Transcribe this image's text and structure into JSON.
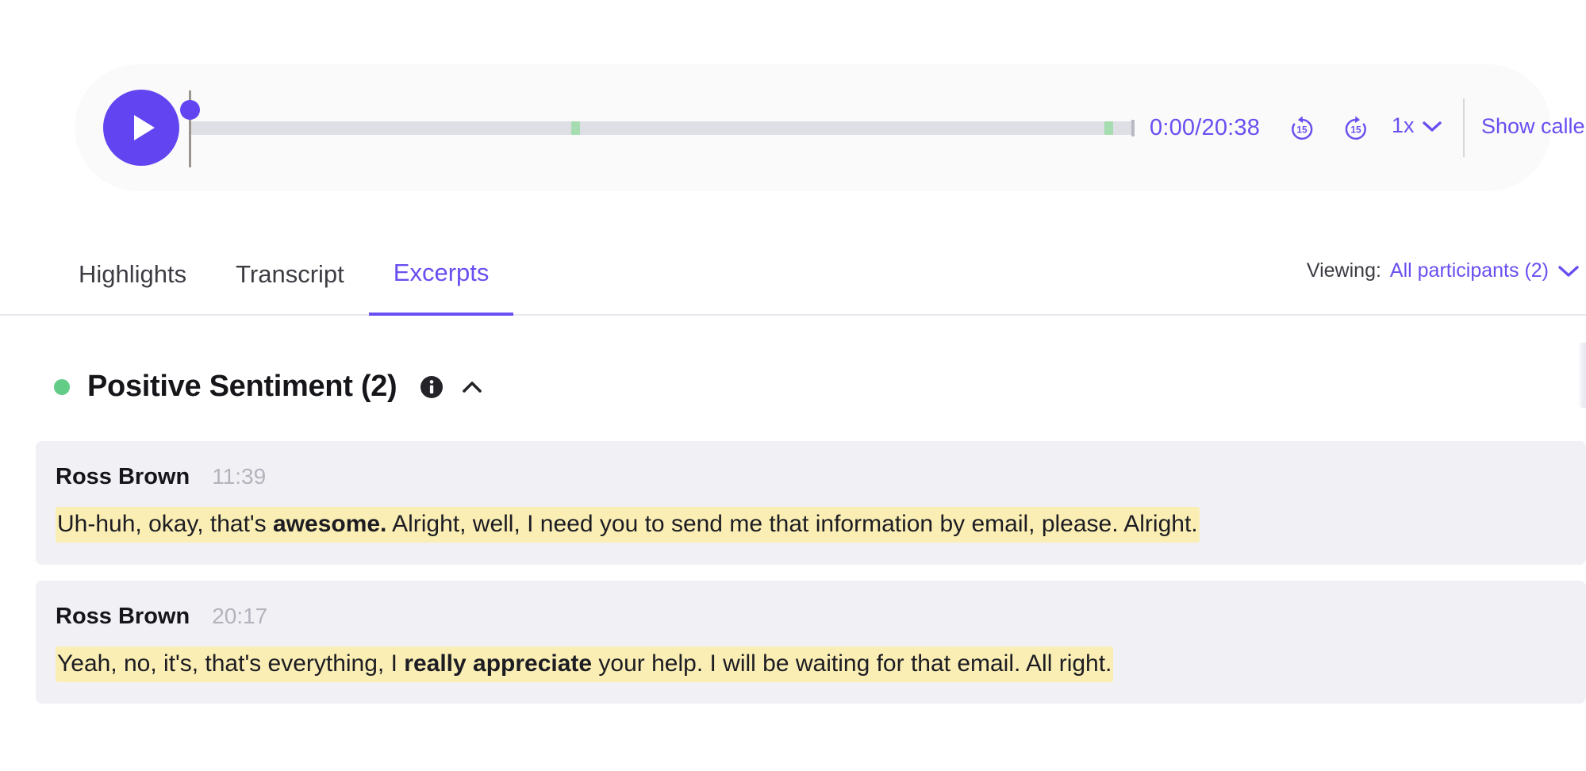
{
  "player": {
    "play_button_label": "play",
    "current_time": "0:00",
    "total_time": "20:38",
    "time_readout": "0:00/20:38",
    "rewind_label": "15",
    "forward_label": "15",
    "speed_label": "1x",
    "show_callers_label": "Show callers",
    "progress_percent": 0,
    "markers_percent": [
      40.5,
      97.0
    ],
    "accent_color": "#6244f0",
    "marker_color": "#a5dcb0",
    "track_color": "#dedee5"
  },
  "tabs": [
    {
      "label": "Highlights",
      "active": false
    },
    {
      "label": "Transcript",
      "active": false
    },
    {
      "label": "Excerpts",
      "active": true
    }
  ],
  "viewing": {
    "label": "Viewing:",
    "value": "All participants (2)",
    "chevron": "chevron-down-icon"
  },
  "section": {
    "dot_color": "#63cc86",
    "title": "Positive Sentiment (2)",
    "info_icon": "info-icon",
    "collapse_icon": "chevron-up-icon",
    "expanded": true
  },
  "excerpts": [
    {
      "speaker": "Ross Brown",
      "timestamp": "11:39",
      "text_parts": [
        {
          "text": "Uh-huh, okay, that's ",
          "bold": false
        },
        {
          "text": "awesome.",
          "bold": true
        },
        {
          "text": " Alright, well, I need you to send me that information by email, please. Alright.",
          "bold": false
        }
      ],
      "full_text": "Uh-huh, okay, that's awesome. Alright, well, I need you to send me that information by email, please. Alright.",
      "pre_bold": "Uh-huh, okay, that's ",
      "bold": "awesome.",
      "post_bold": " Alright, well, I need you to send me that information by email, please. Alright.",
      "highlight_color": "#faeeb5"
    },
    {
      "speaker": "Ross Brown",
      "timestamp": "20:17",
      "text_parts": [
        {
          "text": "Yeah, no, it's, that's everything, I ",
          "bold": false
        },
        {
          "text": "really appreciate",
          "bold": true
        },
        {
          "text": " your help. I will be waiting for that email. All right.",
          "bold": false
        }
      ],
      "full_text": "Yeah, no, it's, that's everything, I really appreciate your help. I will be waiting for that email. All right.",
      "pre_bold": "Yeah, no, it's, that's everything, I ",
      "bold": "really appreciate",
      "post_bold": " your help. I will be waiting for that email. All right.",
      "highlight_color": "#faeeb5"
    }
  ]
}
